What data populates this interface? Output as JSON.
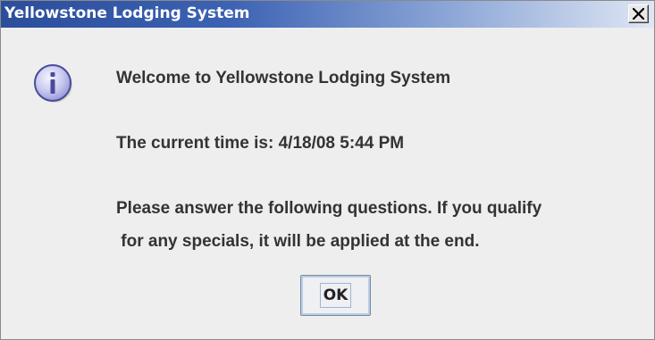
{
  "window": {
    "title": "Yellowstone Lodging System"
  },
  "dialog": {
    "icon": "info-icon",
    "messages": [
      "Welcome to Yellowstone Lodging System",
      "The current time is: 4/18/08 5:44 PM",
      "Please answer the following questions. If you qualify",
      " for any specials, it will be applied at the end."
    ],
    "ok_label": "OK"
  },
  "colors": {
    "titlebar_start": "#2b4e9b",
    "titlebar_end": "#dfe6f4",
    "dialog_background": "#eeeeee",
    "icon_fill": "#c8c8f0",
    "icon_border": "#4a4a9a"
  }
}
